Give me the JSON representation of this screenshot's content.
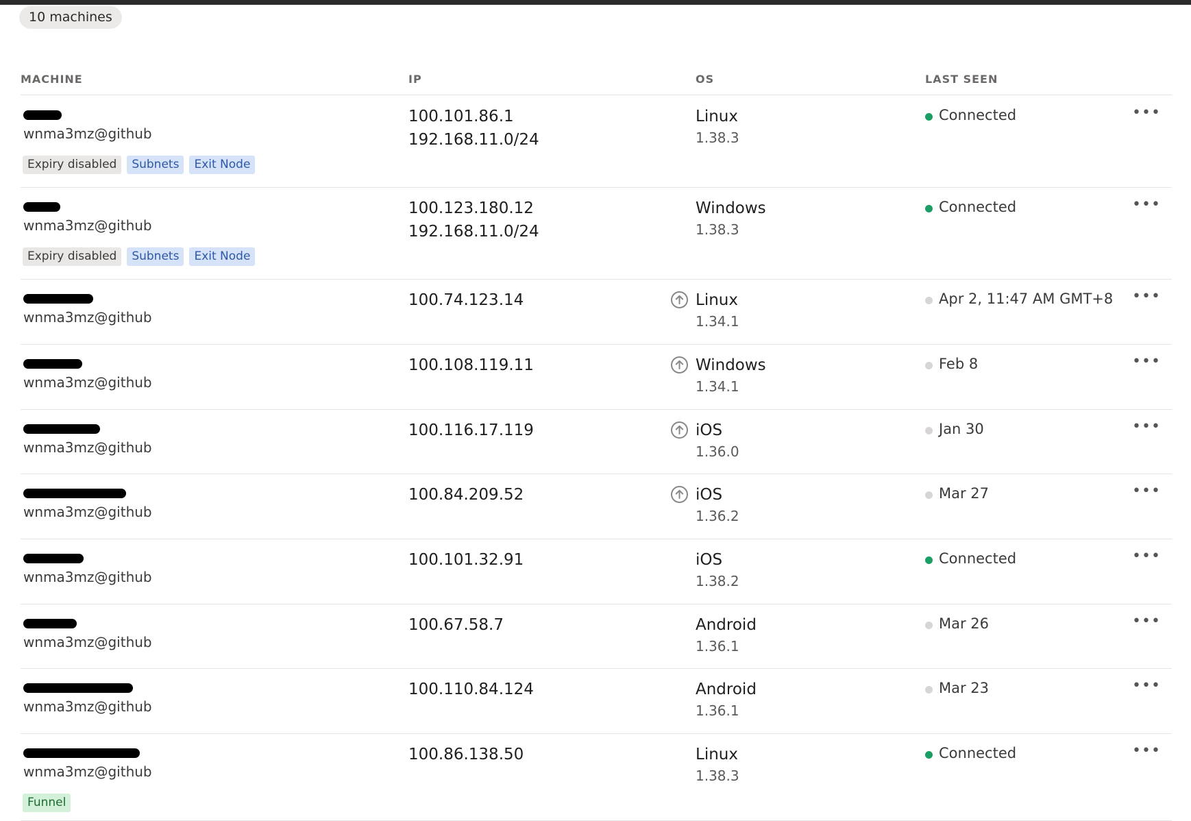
{
  "summary": {
    "count_label": "10 machines"
  },
  "columns": {
    "machine": "MACHINE",
    "ip": "IP",
    "os": "OS",
    "last_seen": "LAST SEEN"
  },
  "colors": {
    "connected": "#1a9e63",
    "offline": "#d8d6d4"
  },
  "machines": [
    {
      "owner": "wnma3mz@github",
      "ips": [
        "100.101.86.1",
        "192.168.11.0/24"
      ],
      "os": "Linux",
      "version": "1.38.3",
      "update_available": false,
      "connected": true,
      "last_seen": "Connected",
      "tags": [
        {
          "label": "Expiry disabled",
          "color": "gray"
        },
        {
          "label": "Subnets",
          "color": "blue"
        },
        {
          "label": "Exit Node",
          "color": "blue"
        }
      ]
    },
    {
      "owner": "wnma3mz@github",
      "ips": [
        "100.123.180.12",
        "192.168.11.0/24"
      ],
      "os": "Windows",
      "version": "1.38.3",
      "update_available": false,
      "connected": true,
      "last_seen": "Connected",
      "tags": [
        {
          "label": "Expiry disabled",
          "color": "gray"
        },
        {
          "label": "Subnets",
          "color": "blue"
        },
        {
          "label": "Exit Node",
          "color": "blue"
        }
      ]
    },
    {
      "owner": "wnma3mz@github",
      "ips": [
        "100.74.123.14"
      ],
      "os": "Linux",
      "version": "1.34.1",
      "update_available": true,
      "connected": false,
      "last_seen": "Apr 2, 11:47 AM GMT+8",
      "tags": []
    },
    {
      "owner": "wnma3mz@github",
      "ips": [
        "100.108.119.11"
      ],
      "os": "Windows",
      "version": "1.34.1",
      "update_available": true,
      "connected": false,
      "last_seen": "Feb 8",
      "tags": []
    },
    {
      "owner": "wnma3mz@github",
      "ips": [
        "100.116.17.119"
      ],
      "os": "iOS",
      "version": "1.36.0",
      "update_available": true,
      "connected": false,
      "last_seen": "Jan 30",
      "tags": []
    },
    {
      "owner": "wnma3mz@github",
      "ips": [
        "100.84.209.52"
      ],
      "os": "iOS",
      "version": "1.36.2",
      "update_available": true,
      "connected": false,
      "last_seen": "Mar 27",
      "tags": []
    },
    {
      "owner": "wnma3mz@github",
      "ips": [
        "100.101.32.91"
      ],
      "os": "iOS",
      "version": "1.38.2",
      "update_available": false,
      "connected": true,
      "last_seen": "Connected",
      "tags": []
    },
    {
      "owner": "wnma3mz@github",
      "ips": [
        "100.67.58.7"
      ],
      "os": "Android",
      "version": "1.36.1",
      "update_available": false,
      "connected": false,
      "last_seen": "Mar 26",
      "tags": []
    },
    {
      "owner": "wnma3mz@github",
      "ips": [
        "100.110.84.124"
      ],
      "os": "Android",
      "version": "1.36.1",
      "update_available": false,
      "connected": false,
      "last_seen": "Mar 23",
      "tags": []
    },
    {
      "owner": "wnma3mz@github",
      "ips": [
        "100.86.138.50"
      ],
      "os": "Linux",
      "version": "1.38.3",
      "update_available": false,
      "connected": true,
      "last_seen": "Connected",
      "tags": [
        {
          "label": "Funnel",
          "color": "green"
        }
      ]
    }
  ]
}
